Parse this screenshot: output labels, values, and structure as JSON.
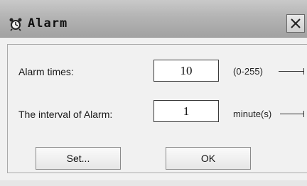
{
  "window": {
    "title": "Alarm",
    "icon": "alarm-bell-icon",
    "close_icon": "close-icon"
  },
  "form": {
    "alarm_times": {
      "label": "Alarm times:",
      "value": "10",
      "hint": "(0-255)"
    },
    "interval": {
      "label": "The interval of Alarm:",
      "value": "1",
      "hint": "minute(s)"
    }
  },
  "buttons": {
    "set_label": "Set...",
    "ok_label": "OK"
  }
}
